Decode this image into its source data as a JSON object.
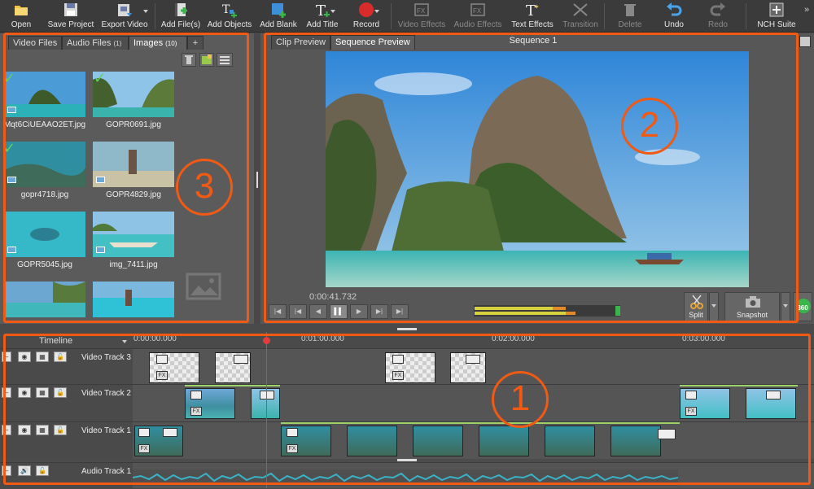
{
  "toolbar": {
    "items": [
      {
        "label": "Open",
        "icon": "folder-icon"
      },
      {
        "label": "Save Project",
        "icon": "save-icon"
      },
      {
        "label": "Export Video",
        "icon": "export-video-icon"
      },
      {
        "label": "Add File(s)",
        "icon": "add-files-icon"
      },
      {
        "label": "Add Objects",
        "icon": "add-objects-icon"
      },
      {
        "label": "Add Blank",
        "icon": "add-blank-icon"
      },
      {
        "label": "Add Title",
        "icon": "add-title-icon"
      },
      {
        "label": "Record",
        "icon": "record-icon"
      },
      {
        "label": "Video Effects",
        "icon": "video-effects-icon"
      },
      {
        "label": "Audio Effects",
        "icon": "audio-effects-icon"
      },
      {
        "label": "Text Effects",
        "icon": "text-effects-icon"
      },
      {
        "label": "Transition",
        "icon": "transition-icon"
      },
      {
        "label": "Delete",
        "icon": "delete-icon"
      },
      {
        "label": "Undo",
        "icon": "undo-icon"
      },
      {
        "label": "Redo",
        "icon": "redo-icon"
      },
      {
        "label": "NCH Suite",
        "icon": "nch-suite-icon"
      }
    ]
  },
  "media": {
    "tabs": [
      "Video Files",
      "Audio Files",
      "(1)",
      "Images",
      "(10)",
      "+"
    ],
    "items": [
      {
        "name": "Mqt6CiUEAAO2ET.jpg",
        "checked": true
      },
      {
        "name": "GOPR0691.jpg",
        "checked": true
      },
      {
        "name": "gopr4718.jpg",
        "checked": true
      },
      {
        "name": "GOPR4829.jpg",
        "checked": false
      },
      {
        "name": "GOPR5045.jpg",
        "checked": false
      },
      {
        "name": "img_7411.jpg",
        "checked": false
      },
      {
        "name": "",
        "checked": false
      },
      {
        "name": "",
        "checked": false
      }
    ]
  },
  "preview": {
    "tabs": [
      "Clip Preview",
      "Sequence Preview"
    ],
    "title": "Sequence 1",
    "timecode": "0:00:41.732",
    "split_label": "Split",
    "snapshot_label": "Snapshot",
    "view_label": "360"
  },
  "timeline": {
    "label": "Timeline",
    "ruler": [
      "0:00:00.000",
      "0:01:00.000",
      "0:02:00.000",
      "0:03:00.000"
    ],
    "tracks": [
      "Video Track 3",
      "Video Track 2",
      "Video Track 1",
      "Audio Track 1"
    ]
  },
  "callouts": [
    "1",
    "2",
    "3"
  ],
  "colors": {
    "accent": "#f05a14",
    "check": "#5fd35f",
    "playhead": "#e23c3c",
    "audio": "#39b3c6"
  }
}
